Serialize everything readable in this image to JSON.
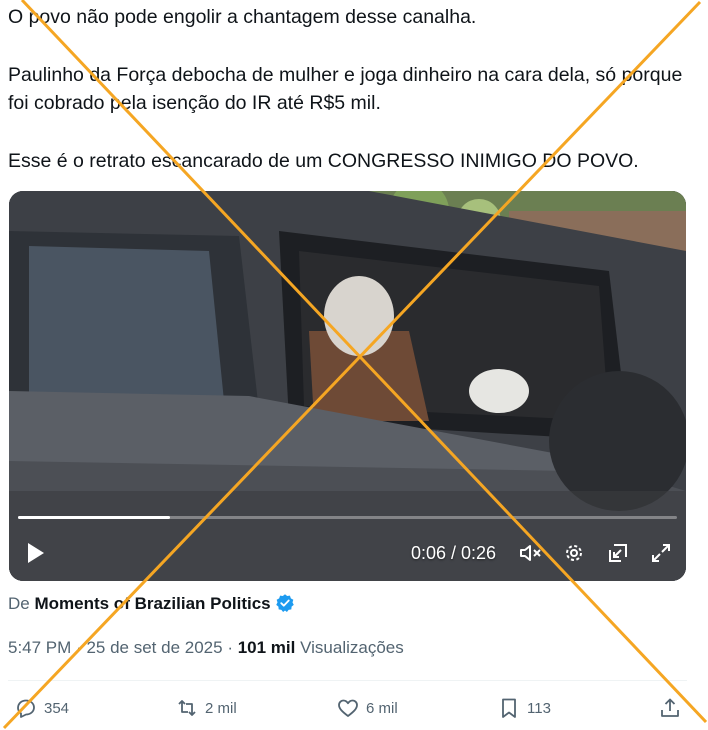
{
  "tweet": {
    "paragraphs": [
      "O povo não pode engolir a chantagem desse canalha.",
      "Paulinho da Força debocha de mulher e joga dinheiro na cara dela, só porque foi cobrado pela isenção do IR até R$5 mil.",
      "Esse é o retrato escancarado de um CONGRESSO INIMIGO DO POVO."
    ]
  },
  "video": {
    "time": "0:06 / 0:26",
    "progress_fraction": 0.23,
    "controls": [
      "play-icon",
      "volume-icon",
      "settings-icon",
      "pip-icon",
      "fullscreen-icon"
    ]
  },
  "source": {
    "prefix": "De",
    "account": "Moments of Brazilian Politics",
    "verified_color": "#1d9bf0"
  },
  "meta": {
    "time": "5:47 PM",
    "sep1": "·",
    "date": "25 de set de 2025",
    "sep2": "·",
    "views_count": "101 mil",
    "views_label": "Visualizações"
  },
  "actions": {
    "replies": "354",
    "reposts": "2 mil",
    "likes": "6 mil",
    "bookmarks": "113"
  },
  "overlay": {
    "cross_color": "#f5a623"
  }
}
